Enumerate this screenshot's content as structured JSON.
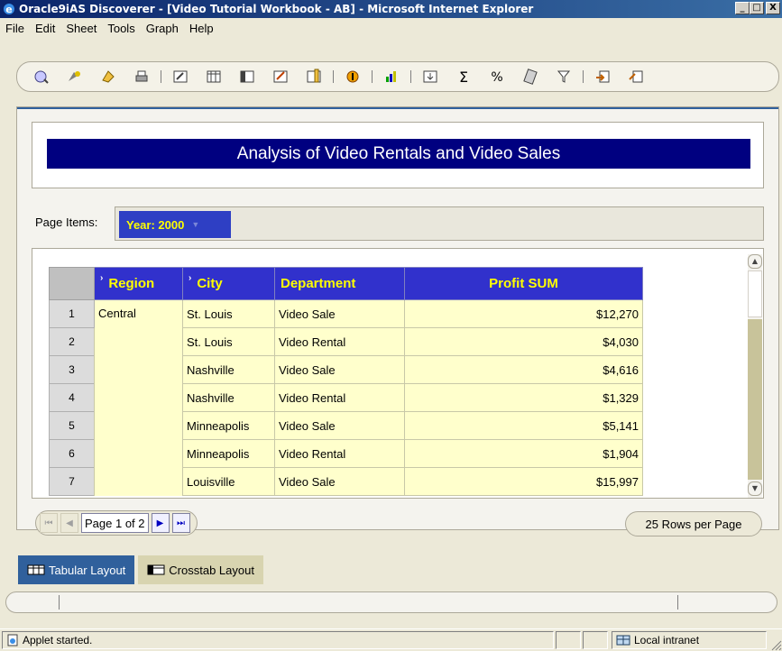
{
  "window": {
    "title": "Oracle9iAS Discoverer - [Video Tutorial Workbook - AB] - Microsoft Internet Explorer",
    "minimize": "_",
    "maximize": "□",
    "close": "X"
  },
  "menu": [
    "File",
    "Edit",
    "Sheet",
    "Tools",
    "Graph",
    "Help"
  ],
  "toolbar": {
    "icons": [
      "new-workbook-icon",
      "open-workbook-icon",
      "save-workbook-icon",
      "print-icon",
      "edit-sheet-icon",
      "table-layout-icon",
      "crosstab-layout-icon",
      "edit-title-icon",
      "format-columns-icon",
      "drill-icon",
      "graph-icon",
      "pivot-icon",
      "sum-icon",
      "percent-icon",
      "calculation-icon",
      "filter-icon",
      "export-icon",
      "schedule-icon"
    ]
  },
  "report": {
    "title": "Analysis of Video Rentals and Video Sales",
    "page_items_label": "Page Items:",
    "page_item_value": "Year: 2000"
  },
  "table": {
    "columns": [
      "Region",
      "City",
      "Department",
      "Profit SUM"
    ],
    "rows": [
      {
        "num": "1",
        "region": "Central",
        "city": "St. Louis",
        "department": "Video Sale",
        "profit": "$12,270"
      },
      {
        "num": "2",
        "region": "",
        "city": "St. Louis",
        "department": "Video Rental",
        "profit": "$4,030"
      },
      {
        "num": "3",
        "region": "",
        "city": "Nashville",
        "department": "Video Sale",
        "profit": "$4,616"
      },
      {
        "num": "4",
        "region": "",
        "city": "Nashville",
        "department": "Video Rental",
        "profit": "$1,329"
      },
      {
        "num": "5",
        "region": "",
        "city": "Minneapolis",
        "department": "Video Sale",
        "profit": "$5,141"
      },
      {
        "num": "6",
        "region": "",
        "city": "Minneapolis",
        "department": "Video Rental",
        "profit": "$1,904"
      },
      {
        "num": "7",
        "region": "",
        "city": "Louisville",
        "department": "Video Sale",
        "profit": "$15,997"
      }
    ]
  },
  "pager": {
    "label": "Page 1 of 2",
    "rows_per_page": "25 Rows per Page"
  },
  "tabs": [
    {
      "label": "Tabular Layout",
      "active": true
    },
    {
      "label": "Crosstab Layout",
      "active": false
    }
  ],
  "status": {
    "text": "Applet started.",
    "zone": "Local intranet"
  },
  "colors": {
    "title_banner": "#000080",
    "header_bg": "#3131cc",
    "header_text": "#ffff00",
    "cell_bg": "#ffffcc"
  }
}
